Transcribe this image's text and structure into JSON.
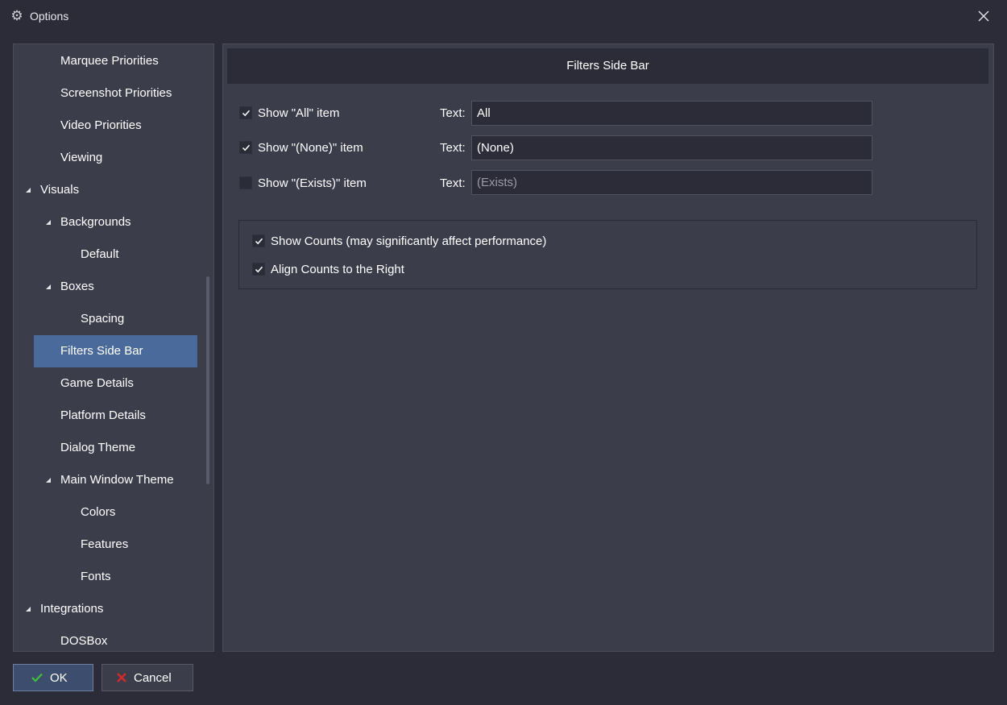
{
  "window": {
    "title": "Options",
    "icon": "gear-icon",
    "close_icon": "close-icon"
  },
  "tree": {
    "items": [
      {
        "label": "Marquee Priorities"
      },
      {
        "label": "Screenshot Priorities"
      },
      {
        "label": "Video Priorities"
      },
      {
        "label": "Viewing"
      },
      {
        "label": "Visuals",
        "expanded": true
      },
      {
        "label": "Backgrounds",
        "expanded": true
      },
      {
        "label": "Default"
      },
      {
        "label": "Boxes",
        "expanded": true
      },
      {
        "label": "Spacing"
      },
      {
        "label": "Filters Side Bar",
        "selected": true
      },
      {
        "label": "Game Details"
      },
      {
        "label": "Platform Details"
      },
      {
        "label": "Dialog Theme"
      },
      {
        "label": "Main Window Theme",
        "expanded": true
      },
      {
        "label": "Colors"
      },
      {
        "label": "Features"
      },
      {
        "label": "Fonts"
      },
      {
        "label": "Integrations",
        "expanded": true
      },
      {
        "label": "DOSBox"
      }
    ]
  },
  "content": {
    "header": "Filters Side Bar",
    "rows": [
      {
        "checkbox_label": "Show \"All\" item",
        "checked": true,
        "text_label": "Text:",
        "value": "All",
        "placeholder": ""
      },
      {
        "checkbox_label": "Show \"(None)\" item",
        "checked": true,
        "text_label": "Text:",
        "value": "(None)",
        "placeholder": ""
      },
      {
        "checkbox_label": "Show \"(Exists)\" item",
        "checked": false,
        "text_label": "Text:",
        "value": "",
        "placeholder": "(Exists)"
      }
    ],
    "counts": {
      "show_counts_label": "Show Counts (may significantly affect performance)",
      "show_counts_checked": true,
      "align_right_label": "Align Counts to the Right",
      "align_right_checked": true
    }
  },
  "buttons": {
    "ok_label": "OK",
    "cancel_label": "Cancel"
  },
  "colors": {
    "background": "#2b2c38",
    "panel": "#3b3d4b",
    "selection": "#4a6a9b",
    "ok_check": "#3cc13c",
    "cancel_x": "#d42a2a"
  }
}
